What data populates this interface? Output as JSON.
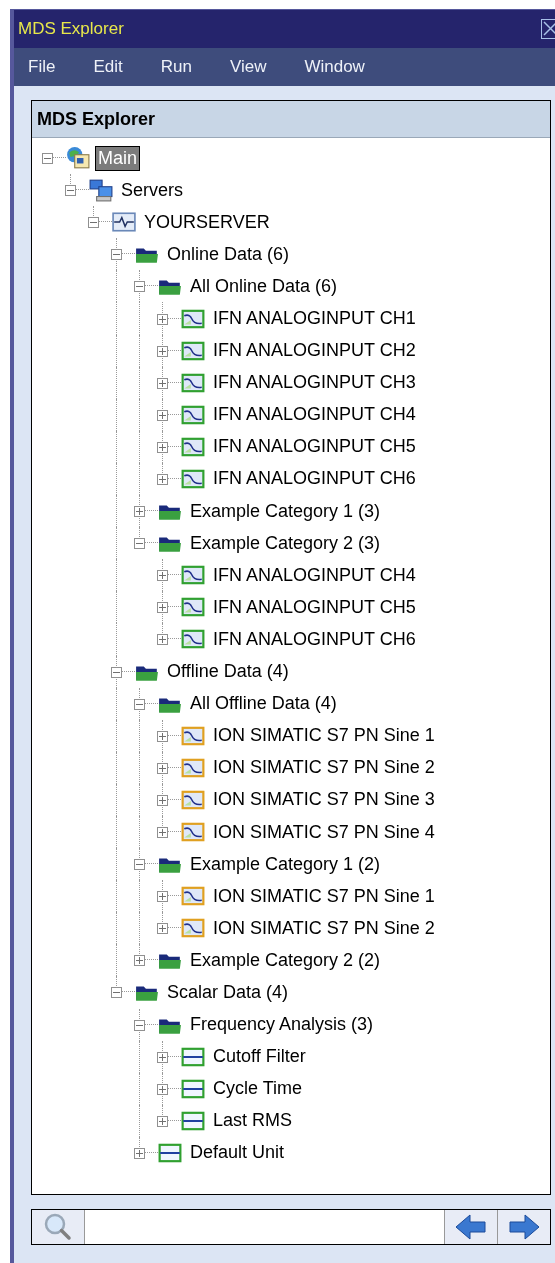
{
  "window": {
    "title": "MDS Explorer"
  },
  "menu": [
    "File",
    "Edit",
    "Run",
    "View",
    "Window"
  ],
  "panel": {
    "title": "MDS Explorer"
  },
  "tree": [
    {
      "label": "Main",
      "kind": "main",
      "expanded": true,
      "selected": true,
      "children": [
        {
          "label": "Servers",
          "kind": "servers",
          "expanded": true,
          "selected": false,
          "children": [
            {
              "label": "YOURSERVER",
              "kind": "server",
              "expanded": true,
              "selected": false,
              "children": [
                {
                  "label": "Online Data (6)",
                  "kind": "folder",
                  "expanded": true,
                  "selected": false,
                  "children": [
                    {
                      "label": "All Online Data (6)",
                      "kind": "folder",
                      "expanded": true,
                      "selected": false,
                      "children": [
                        {
                          "label": "IFN ANALOGINPUT CH1",
                          "kind": "online",
                          "expanded": false,
                          "selected": false
                        },
                        {
                          "label": "IFN ANALOGINPUT CH2",
                          "kind": "online",
                          "expanded": false,
                          "selected": false
                        },
                        {
                          "label": "IFN ANALOGINPUT CH3",
                          "kind": "online",
                          "expanded": false,
                          "selected": false
                        },
                        {
                          "label": "IFN ANALOGINPUT CH4",
                          "kind": "online",
                          "expanded": false,
                          "selected": false
                        },
                        {
                          "label": "IFN ANALOGINPUT CH5",
                          "kind": "online",
                          "expanded": false,
                          "selected": false
                        },
                        {
                          "label": "IFN ANALOGINPUT CH6",
                          "kind": "online",
                          "expanded": false,
                          "selected": false
                        }
                      ]
                    },
                    {
                      "label": "Example Category 1 (3)",
                      "kind": "folder",
                      "expanded": false,
                      "selected": false
                    },
                    {
                      "label": "Example Category 2 (3)",
                      "kind": "folder",
                      "expanded": true,
                      "selected": false,
                      "children": [
                        {
                          "label": "IFN ANALOGINPUT CH4",
                          "kind": "online",
                          "expanded": false,
                          "selected": false
                        },
                        {
                          "label": "IFN ANALOGINPUT CH5",
                          "kind": "online",
                          "expanded": false,
                          "selected": false
                        },
                        {
                          "label": "IFN ANALOGINPUT CH6",
                          "kind": "online",
                          "expanded": false,
                          "selected": false
                        }
                      ]
                    }
                  ]
                },
                {
                  "label": "Offline Data (4)",
                  "kind": "folder",
                  "expanded": true,
                  "selected": false,
                  "children": [
                    {
                      "label": "All Offline Data (4)",
                      "kind": "folder",
                      "expanded": true,
                      "selected": false,
                      "children": [
                        {
                          "label": "ION SIMATIC S7 PN Sine 1",
                          "kind": "offline",
                          "expanded": false,
                          "selected": false
                        },
                        {
                          "label": "ION SIMATIC S7 PN Sine 2",
                          "kind": "offline",
                          "expanded": false,
                          "selected": false
                        },
                        {
                          "label": "ION SIMATIC S7 PN Sine 3",
                          "kind": "offline",
                          "expanded": false,
                          "selected": false
                        },
                        {
                          "label": "ION SIMATIC S7 PN Sine 4",
                          "kind": "offline",
                          "expanded": false,
                          "selected": false
                        }
                      ]
                    },
                    {
                      "label": "Example Category 1 (2)",
                      "kind": "folder",
                      "expanded": true,
                      "selected": false,
                      "children": [
                        {
                          "label": "ION SIMATIC S7 PN Sine 1",
                          "kind": "offline",
                          "expanded": false,
                          "selected": false
                        },
                        {
                          "label": "ION SIMATIC S7 PN Sine 2",
                          "kind": "offline",
                          "expanded": false,
                          "selected": false
                        }
                      ]
                    },
                    {
                      "label": "Example Category 2 (2)",
                      "kind": "folder",
                      "expanded": false,
                      "selected": false
                    }
                  ]
                },
                {
                  "label": "Scalar Data (4)",
                  "kind": "folder",
                  "expanded": true,
                  "selected": false,
                  "children": [
                    {
                      "label": "Frequency Analysis (3)",
                      "kind": "folder",
                      "expanded": true,
                      "selected": false,
                      "children": [
                        {
                          "label": "Cutoff Filter",
                          "kind": "scalar",
                          "expanded": false,
                          "selected": false
                        },
                        {
                          "label": "Cycle Time",
                          "kind": "scalar",
                          "expanded": false,
                          "selected": false
                        },
                        {
                          "label": "Last RMS",
                          "kind": "scalar",
                          "expanded": false,
                          "selected": false
                        }
                      ]
                    },
                    {
                      "label": "Default Unit",
                      "kind": "scalar",
                      "expanded": false,
                      "selected": false
                    }
                  ]
                }
              ]
            }
          ]
        }
      ]
    }
  ]
}
